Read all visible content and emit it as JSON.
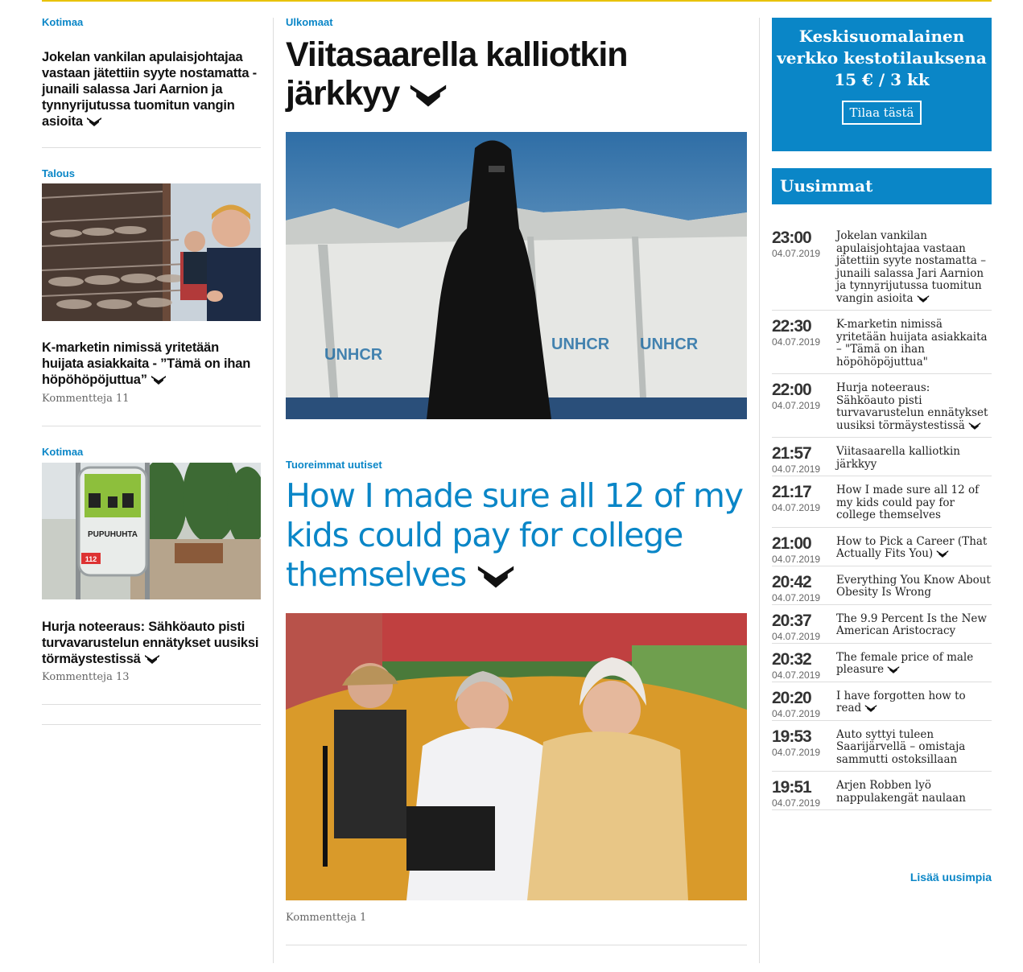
{
  "left": {
    "a1": {
      "category": "Kotimaa",
      "title": "Jokelan vankilan apulaisjohtajaa vastaan jätettiin syyte nostamatta - junaili salassa Jari Aarnion ja tynnyrijutussa tuomitun vangin asioita"
    },
    "a2": {
      "category": "Talous",
      "title": "K-marketin nimissä yritetään huijata asiakkaita - ”Tämä on ihan höpöhöpöjuttua”",
      "comments": "Kommentteja 11"
    },
    "a3": {
      "category": "Kotimaa",
      "title": "Hurja noteeraus: Sähköauto pisti turvavarustelun ennätykset uusiksi törmäystestissä",
      "comments": "Kommentteja 13",
      "sign": "PUPUHUHTA",
      "sign_number": "112"
    }
  },
  "center": {
    "main": {
      "category": "Ulkomaat",
      "title": "Viitasaarella kalliotkin järkkyy",
      "tent_text": "UNHCR"
    },
    "second": {
      "category": "Tuoreimmat uutiset",
      "title": "How I made sure all 12 of my kids could pay for college themselves",
      "comments": "Kommentteja 1"
    }
  },
  "promo": {
    "line1": "Keskisuomalainen",
    "line2": "verkko kestotilauksena",
    "price": "15 € / 3 kk",
    "button": "Tilaa tästä"
  },
  "latest": {
    "heading": "Uusimmat",
    "items": [
      {
        "time": "23:00",
        "date": "04.07.2019",
        "text": "Jokelan vankilan apulaisjohtajaa vastaan jätettiin syyte nostamatta – junaili salassa Jari Aarnion ja tynnyrijutussa tuomitun vangin asioita",
        "premium": true
      },
      {
        "time": "22:30",
        "date": "04.07.2019",
        "text": "K-marketin nimissä yritetään huijata asiakkaita – \"Tämä on ihan höpöhöpöjuttua\"",
        "premium": false
      },
      {
        "time": "22:00",
        "date": "04.07.2019",
        "text": "Hurja noteeraus: Sähköauto pisti turvavarustelun ennätykset uusiksi törmäystestissä",
        "premium": true
      },
      {
        "time": "21:57",
        "date": "04.07.2019",
        "text": "Viitasaarella kalliotkin järkkyy",
        "premium": false
      },
      {
        "time": "21:17",
        "date": "04.07.2019",
        "text": "How I made sure all 12 of my kids could pay for college themselves",
        "premium": false
      },
      {
        "time": "21:00",
        "date": "04.07.2019",
        "text": "How to Pick a Career (That Actually Fits You)",
        "premium": true
      },
      {
        "time": "20:42",
        "date": "04.07.2019",
        "text": "Everything You Know About Obesity Is Wrong",
        "premium": false
      },
      {
        "time": "20:37",
        "date": "04.07.2019",
        "text": "The 9.9 Percent Is the New American Aristocracy",
        "premium": false
      },
      {
        "time": "20:32",
        "date": "04.07.2019",
        "text": "The female price of male pleasure",
        "premium": true
      },
      {
        "time": "20:20",
        "date": "04.07.2019",
        "text": "I have forgotten how to read",
        "premium": true
      },
      {
        "time": "19:53",
        "date": "04.07.2019",
        "text": "Auto syttyi tuleen Saarijärvellä – omistaja sammutti ostoksillaan",
        "premium": false
      },
      {
        "time": "19:51",
        "date": "04.07.2019",
        "text": "Arjen Robben lyö nappulakengät naulaan",
        "premium": false
      }
    ],
    "more": "Lisää uusimpia"
  },
  "colors": {
    "accent": "#0a86c7",
    "topline": "#e8c200",
    "text": "#111111"
  },
  "icons": {
    "premium": "premium-chevron-icon"
  }
}
